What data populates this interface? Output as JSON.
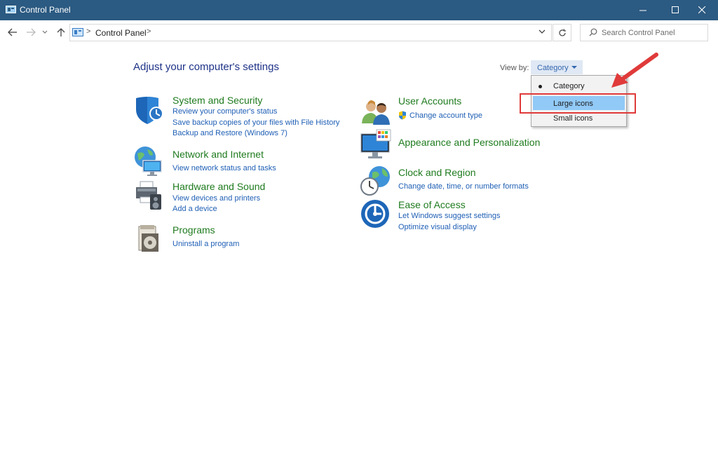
{
  "window": {
    "title": "Control Panel"
  },
  "address": {
    "breadcrumb": "Control Panel",
    "separator": ">"
  },
  "search": {
    "placeholder": "Search Control Panel"
  },
  "main": {
    "heading": "Adjust your computer's settings",
    "view_by_label": "View by:",
    "view_by_value": "Category"
  },
  "view_menu": {
    "items": [
      {
        "label": "Category",
        "selected": true
      },
      {
        "label": "Large icons",
        "highlighted": true
      },
      {
        "label": "Small icons"
      }
    ]
  },
  "categories": [
    {
      "title": "System and Security",
      "icon": "shield-icon",
      "links": [
        "Review your computer's status",
        "Save backup copies of your files with File History",
        "Backup and Restore (Windows 7)"
      ]
    },
    {
      "title": "Network and Internet",
      "icon": "globe-network-icon",
      "links": [
        "View network status and tasks"
      ]
    },
    {
      "title": "Hardware and Sound",
      "icon": "printer-speaker-icon",
      "links": [
        "View devices and printers",
        "Add a device"
      ]
    },
    {
      "title": "Programs",
      "icon": "programs-disc-icon",
      "links": [
        "Uninstall a program"
      ]
    },
    {
      "title": "User Accounts",
      "icon": "users-icon",
      "links": [
        "Change account type"
      ]
    },
    {
      "title": "Appearance and Personalization",
      "icon": "monitor-palette-icon",
      "links": []
    },
    {
      "title": "Clock and Region",
      "icon": "clock-globe-icon",
      "links": [
        "Change date, time, or number formats"
      ]
    },
    {
      "title": "Ease of Access",
      "icon": "ease-of-access-icon",
      "links": [
        "Let Windows suggest settings",
        "Optimize visual display"
      ]
    }
  ],
  "colors": {
    "titlebar": "#2b5a82",
    "category_title": "#1f7b1f",
    "link": "#1f5fb5",
    "highlight": "#91c9f7",
    "annotation": "#e03a3a"
  }
}
